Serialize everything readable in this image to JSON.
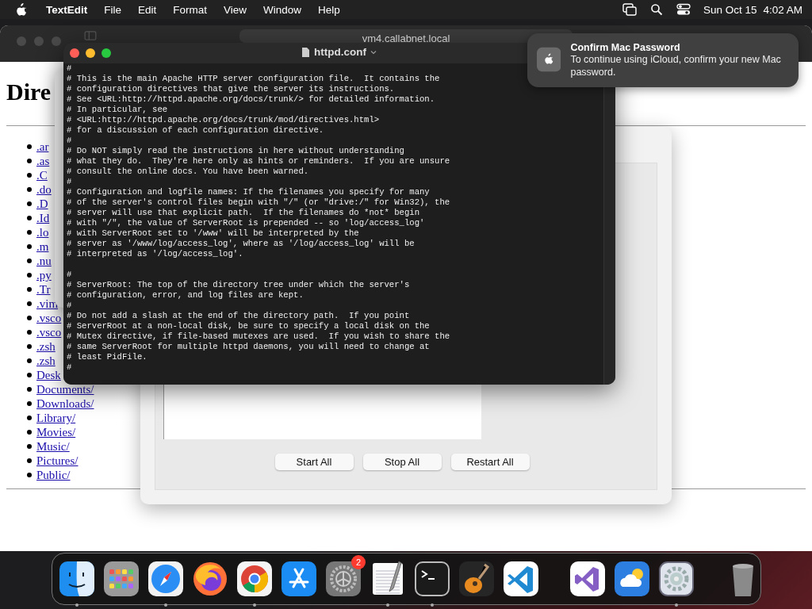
{
  "menu_bar": {
    "app": "TextEdit",
    "menus": [
      "File",
      "Edit",
      "Format",
      "View",
      "Window",
      "Help"
    ],
    "date": "Sun Oct 15",
    "time": "4:02 AM"
  },
  "browser": {
    "address": "vm4.callabnet.local",
    "heading": "Dire",
    "links": [
      ".ar",
      ".as",
      ".C",
      ".do",
      ".D",
      ".Id",
      ".lo",
      ".m",
      ".nu",
      ".py",
      ".Tr",
      ".vim",
      ".vsco",
      ".vsco",
      ".zsh",
      ".zsh",
      "Desk",
      "Documents/",
      "Downloads/",
      "Library/",
      "Movies/",
      "Music/",
      "Pictures/",
      "Public/"
    ]
  },
  "control_panel": {
    "buttons": [
      "Start All",
      "Stop All",
      "Restart All"
    ]
  },
  "editor": {
    "title": "httpd.conf",
    "blocks": [
      {
        "lines": [
          "#",
          "# This is the main Apache HTTP server configuration file.  It contains the",
          "# configuration directives that give the server its instructions.",
          "# See <URL:http://httpd.apache.org/docs/trunk/> for detailed information.",
          "# In particular, see",
          "# <URL:http://httpd.apache.org/docs/trunk/mod/directives.html>",
          "# for a discussion of each configuration directive.",
          "#",
          "# Do NOT simply read the instructions in here without understanding",
          "# what they do.  They're here only as hints or reminders.  If you are unsure",
          "# consult the online docs. You have been warned.",
          "#",
          "# Configuration and logfile names: If the filenames you specify for many",
          "# of the server's control files begin with \"/\" (or \"drive:/\" for Win32), the",
          "# server will use that explicit path.  If the filenames do *not* begin",
          "# with \"/\", the value of ServerRoot is prepended -- so 'log/access_log'",
          "# with ServerRoot set to '/www' will be interpreted by the",
          "# server as '/www/log/access_log', where as '/log/access_log' will be",
          "# interpreted as '/log/access_log'."
        ]
      },
      {
        "lines": [
          "#",
          "# ServerRoot: The top of the directory tree under which the server's",
          "# configuration, error, and log files are kept.",
          "#",
          "# Do not add a slash at the end of the directory path.  If you point",
          "# ServerRoot at a non-local disk, be sure to specify a local disk on the",
          "# Mutex directive, if file-based mutexes are used.  If you wish to share the",
          "# same ServerRoot for multiple httpd daemons, you will need to change at",
          "# least PidFile.",
          "#"
        ]
      }
    ]
  },
  "notification": {
    "title": "Confirm Mac Password",
    "body": "To continue using iCloud, confirm your new Mac password."
  },
  "dock": {
    "sections": [
      {
        "items": [
          {
            "kind": "finder",
            "running": true
          },
          {
            "kind": "launchpad",
            "running": false
          },
          {
            "kind": "safari",
            "running": true
          },
          {
            "kind": "firefox",
            "running": false
          },
          {
            "kind": "chrome",
            "running": true
          },
          {
            "kind": "appstore",
            "running": false
          },
          {
            "kind": "settings",
            "running": false,
            "badge": "2"
          },
          {
            "kind": "textedit",
            "running": true
          },
          {
            "kind": "terminal",
            "running": true
          },
          {
            "kind": "garageband",
            "running": false
          },
          {
            "kind": "vscode",
            "running": false
          }
        ]
      },
      {
        "items": [
          {
            "kind": "visualstudio",
            "running": false
          },
          {
            "kind": "weather",
            "running": false
          },
          {
            "kind": "gearapp",
            "running": true
          }
        ]
      },
      {
        "items": [
          {
            "kind": "trash",
            "running": false
          }
        ]
      }
    ]
  }
}
